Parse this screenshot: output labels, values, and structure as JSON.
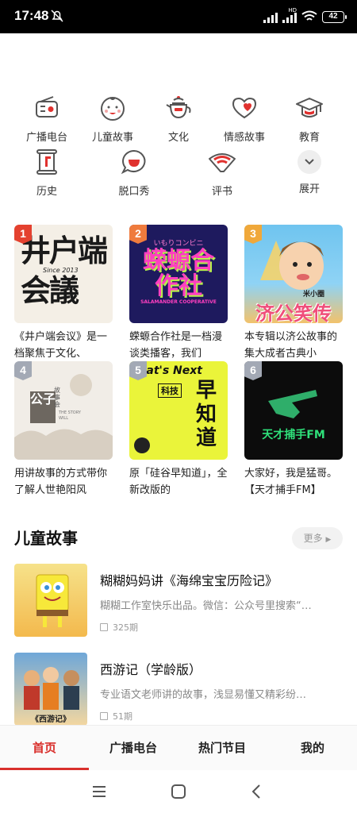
{
  "status_bar": {
    "time": "17:48",
    "battery": "42"
  },
  "categories": [
    {
      "label": "广播电台",
      "icon": "radio-icon"
    },
    {
      "label": "儿童故事",
      "icon": "baby-face-icon"
    },
    {
      "label": "文化",
      "icon": "teapot-icon"
    },
    {
      "label": "情感故事",
      "icon": "heart-icon"
    },
    {
      "label": "教育",
      "icon": "graduation-cap-icon"
    },
    {
      "label": "历史",
      "icon": "scroll-icon"
    },
    {
      "label": "脱口秀",
      "icon": "speech-bubble-icon"
    },
    {
      "label": "评书",
      "icon": "fan-icon"
    },
    {
      "label": "展开",
      "icon": "chevron-down-icon"
    }
  ],
  "ranked_items": [
    {
      "rank": "1",
      "title": "《井户端会议》是一档聚焦于文化、",
      "cover_text": "井户端会議",
      "cover_sub": "Since 2013",
      "rank_color": "#e4412f"
    },
    {
      "rank": "2",
      "title": "蝾螈合作社是一档漫谈类播客，我们",
      "cover_text": "蝾螈合作社",
      "cover_sub": "SALAMANDER COOPERATIVE",
      "cover_top": "いもりコンビニ",
      "rank_color": "#ef7b3d"
    },
    {
      "rank": "3",
      "title": "本专辑以济公故事的集大成者古典小",
      "cover_text": "济公笑传",
      "cover_sub": "米小圈",
      "rank_color": "#f0a83a"
    },
    {
      "rank": "4",
      "title": "用讲故事的方式带你了解人世艳阳风",
      "cover_text": "公子",
      "cover_sub": "故事会",
      "cover_en": "THE STORY WILL",
      "rank_color": "#a3a9b5"
    },
    {
      "rank": "5",
      "title": "原「硅谷早知道」，全新改版的",
      "cover_text": "早知道",
      "cover_top": "What's Next",
      "cover_sub": "科技",
      "rank_color": "#a3a9b5"
    },
    {
      "rank": "6",
      "title": "大家好，我是猛哥。【天才捕手FM】",
      "cover_text": "天才捕手FM",
      "rank_color": "#a3a9b5"
    }
  ],
  "section": {
    "title": "儿童故事",
    "more_label": "更多"
  },
  "list_items": [
    {
      "title": "糊糊妈妈讲《海绵宝宝历险记》",
      "desc": "糊糊工作室快乐出品。微信：公众号里搜索“…",
      "count": "325期"
    },
    {
      "title": "西游记（学龄版）",
      "desc": "专业语文老师讲的故事，浅显易懂又精彩纷…",
      "count": "51期",
      "cover_text": "《西游记》"
    }
  ],
  "tabs": [
    {
      "label": "首页",
      "active": true
    },
    {
      "label": "广播电台"
    },
    {
      "label": "热门节目"
    },
    {
      "label": "我的"
    }
  ],
  "colors": {
    "accent": "#d9302c",
    "icon_stroke": "#555555",
    "icon_red": "#e0312e"
  }
}
